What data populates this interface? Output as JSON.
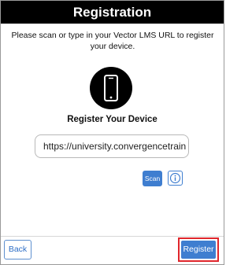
{
  "header": {
    "title": "Registration"
  },
  "instructions": "Please scan or type in your Vector LMS URL to register your device.",
  "device_icon": "mobile-phone-icon",
  "register_heading": "Register Your Device",
  "url_field": {
    "value": "https://university.convergencetrain",
    "placeholder": ""
  },
  "scan_button": {
    "label": "Scan"
  },
  "info_button": {
    "icon": "info-icon"
  },
  "footer": {
    "back_label": "Back",
    "register_label": "Register"
  },
  "colors": {
    "header_bg": "#000000",
    "accent": "#3f7ed0",
    "highlight": "#e0262c"
  }
}
